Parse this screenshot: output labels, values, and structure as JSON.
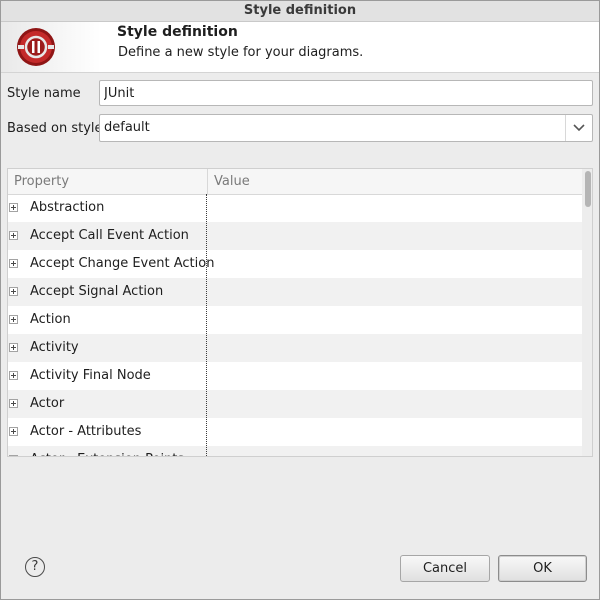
{
  "window": {
    "title": "Style definition"
  },
  "banner": {
    "title": "Style definition",
    "description": "Define a new style for your diagrams.",
    "icon": "style-definition-icon"
  },
  "form": {
    "style_name_label": "Style name",
    "style_name_value": "JUnit",
    "based_on_label": "Based on style",
    "based_on_value": "default"
  },
  "table": {
    "columns": [
      "Property",
      "Value"
    ],
    "rows": [
      {
        "label": "Abstraction",
        "value": ""
      },
      {
        "label": "Accept Call Event Action",
        "value": ""
      },
      {
        "label": "Accept Change Event Action",
        "value": ""
      },
      {
        "label": "Accept Signal Action",
        "value": ""
      },
      {
        "label": "Action",
        "value": ""
      },
      {
        "label": "Activity",
        "value": ""
      },
      {
        "label": "Activity Final Node",
        "value": ""
      },
      {
        "label": "Actor",
        "value": ""
      },
      {
        "label": "Actor - Attributes",
        "value": ""
      },
      {
        "label": "Actor - Extension Points",
        "value": ""
      }
    ]
  },
  "buttons": {
    "cancel": "Cancel",
    "ok": "OK",
    "help": "?"
  },
  "colors": {
    "dialog_bg": "#ececec",
    "banner_icon": "#c42a2a",
    "alt_row": "#f1f1f1"
  }
}
